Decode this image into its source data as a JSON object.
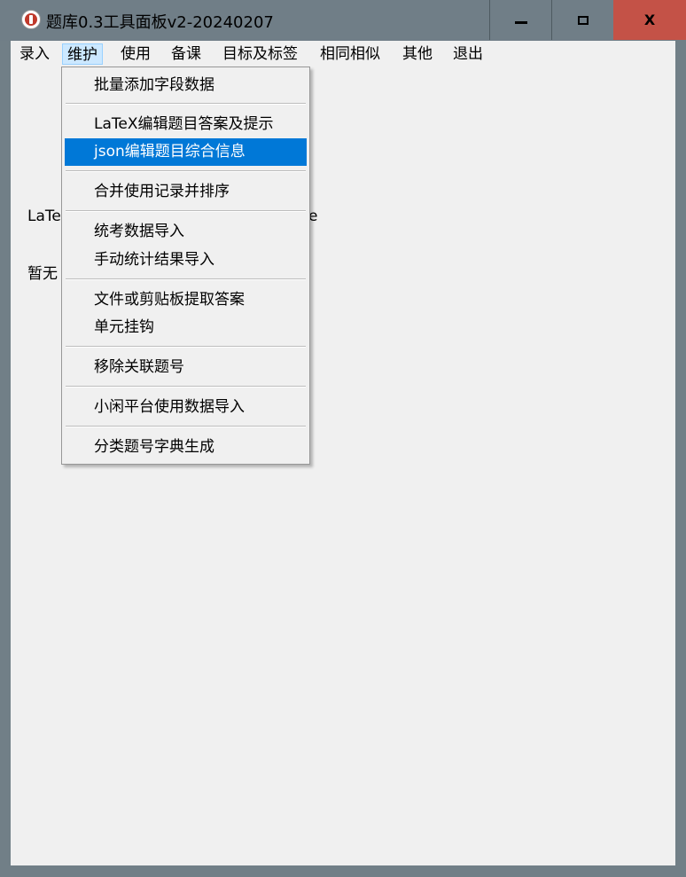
{
  "window": {
    "title": "题库0.3工具面板v2-20240207",
    "controls": {
      "minimize": "minimize",
      "maximize": "maximize",
      "close": "X"
    }
  },
  "menubar": {
    "items": [
      {
        "label": "录入",
        "active": false
      },
      {
        "label": "维护",
        "active": true
      },
      {
        "label": "使用",
        "active": false
      },
      {
        "label": "备课",
        "active": false
      },
      {
        "label": "目标及标签",
        "active": false
      },
      {
        "label": "相同相似",
        "active": false
      },
      {
        "label": "其他",
        "active": false
      },
      {
        "label": "退出",
        "active": false
      }
    ]
  },
  "background": {
    "label_latex": "LaTe",
    "label_latex_tail": "e",
    "label_empty": "暂无"
  },
  "dropdown": {
    "items": [
      {
        "label": "批量添加字段数据"
      },
      {
        "label": "LaTeX编辑题目答案及提示"
      },
      {
        "label": "json编辑题目综合信息",
        "highlighted": true
      },
      {
        "label": "合并使用记录并排序"
      },
      {
        "label": "统考数据导入"
      },
      {
        "label": "手动统计结果导入"
      },
      {
        "label": "文件或剪贴板提取答案"
      },
      {
        "label": "单元挂钩"
      },
      {
        "label": "移除关联题号"
      },
      {
        "label": "小闲平台使用数据导入"
      },
      {
        "label": "分类题号字典生成"
      }
    ]
  },
  "colors": {
    "highlight": "#0078d7",
    "close_button": "#c45247",
    "active_menu": "#cce8ff"
  }
}
